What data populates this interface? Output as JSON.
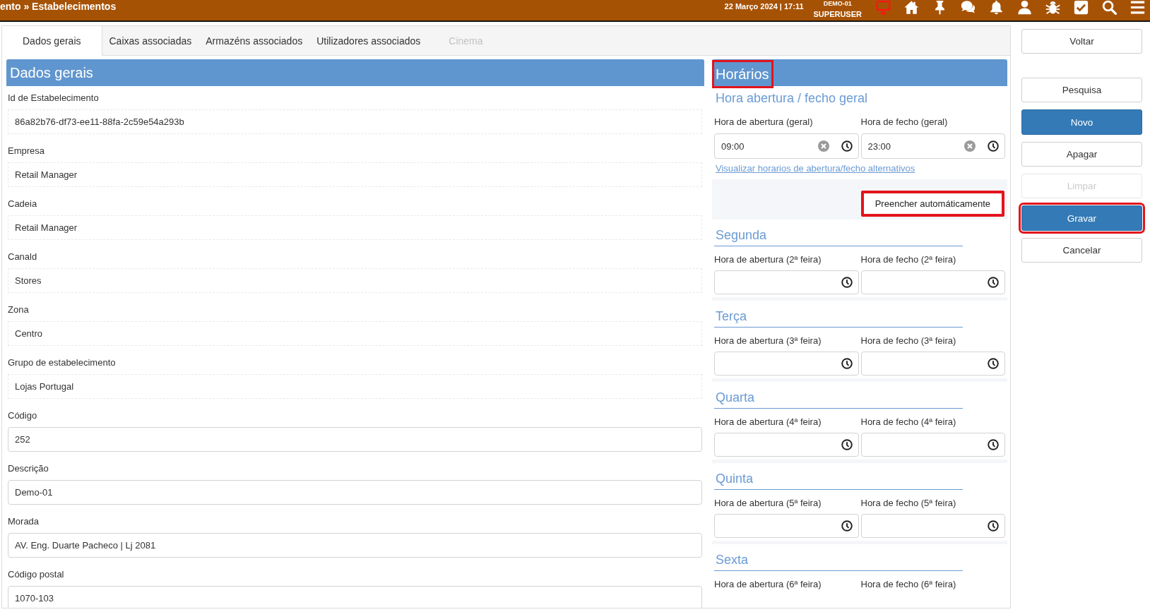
{
  "header": {
    "breadcrumb": "ento » Estabelecimentos",
    "datetime": "22 Março 2024 | 17:11",
    "user_lines": [
      "DEMO-01",
      "SUPERUSER"
    ],
    "monitor_alert": true
  },
  "tabs": [
    {
      "label": "Dados gerais",
      "selected": true,
      "disabled": false
    },
    {
      "label": "Caixas associadas",
      "selected": false,
      "disabled": false
    },
    {
      "label": "Armazéns associados",
      "selected": false,
      "disabled": false
    },
    {
      "label": "Utilizadores associados",
      "selected": false,
      "disabled": false
    },
    {
      "label": "Cinema",
      "selected": false,
      "disabled": true
    }
  ],
  "general_panel": {
    "title": "Dados gerais",
    "fields": [
      {
        "label": "Id de Estabelecimento",
        "value": "86a82b76-df73-ee11-88fa-2c59e54a293b",
        "kind": "readonly"
      },
      {
        "label": "Empresa",
        "value": "Retail Manager",
        "kind": "readonly"
      },
      {
        "label": "Cadeia",
        "value": "Retail Manager",
        "kind": "readonly"
      },
      {
        "label": "Canald",
        "value": "Stores",
        "kind": "readonly"
      },
      {
        "label": "Zona",
        "value": "Centro",
        "kind": "readonly"
      },
      {
        "label": "Grupo de estabelecimento",
        "value": "Lojas Portugal",
        "kind": "readonly"
      },
      {
        "label": "Código",
        "value": "252",
        "kind": "input"
      },
      {
        "label": "Descrição",
        "value": "Demo-01",
        "kind": "input"
      },
      {
        "label": "Morada",
        "value": "AV. Eng. Duarte Pacheco | Lj 2081",
        "kind": "input"
      },
      {
        "label": "Código postal",
        "value": "1070-103",
        "kind": "input"
      }
    ]
  },
  "hours_panel": {
    "title": "Horários",
    "title_highlighted": true,
    "general": {
      "heading": "Hora abertura / fecho geral",
      "fields": [
        {
          "label": "Hora de abertura (geral)",
          "value": "09:00"
        },
        {
          "label": "Hora de fecho (geral)",
          "value": "23:00"
        }
      ],
      "link": "Visualizar horarios de abertura/fecho alternativos"
    },
    "autofill_button": {
      "label": "Preencher automáticamente",
      "highlighted": true
    },
    "days": [
      {
        "name": "Segunda",
        "fields": [
          {
            "label": "Hora de abertura (2ª feira)",
            "input_shown": true
          },
          {
            "label": "Hora de fecho (2ª feira)",
            "input_shown": true
          }
        ]
      },
      {
        "name": "Terça",
        "fields": [
          {
            "label": "Hora de abertura (3ª feira)",
            "input_shown": true
          },
          {
            "label": "Hora de fecho (3ª feira)",
            "input_shown": true
          }
        ]
      },
      {
        "name": "Quarta",
        "fields": [
          {
            "label": "Hora de abertura (4ª feira)",
            "input_shown": true
          },
          {
            "label": "Hora de fecho (4ª feira)",
            "input_shown": true
          }
        ]
      },
      {
        "name": "Quinta",
        "fields": [
          {
            "label": "Hora de abertura (5ª feira)",
            "input_shown": true
          },
          {
            "label": "Hora de fecho (5ª feira)",
            "input_shown": true
          }
        ]
      },
      {
        "name": "Sexta",
        "fields": [
          {
            "label": "Hora de abertura (6ª feira)",
            "input_shown": false
          },
          {
            "label": "Hora de fecho (6ª feira)",
            "input_shown": false
          }
        ]
      }
    ]
  },
  "back_button": {
    "label": "Voltar"
  },
  "actions": [
    {
      "label": "Pesquisa",
      "kind": "default",
      "disabled": false,
      "highlighted": false
    },
    {
      "label": "Novo",
      "kind": "primary",
      "disabled": false,
      "highlighted": false
    },
    {
      "label": "Apagar",
      "kind": "default",
      "disabled": false,
      "highlighted": false
    },
    {
      "label": "Limpar",
      "kind": "default",
      "disabled": true,
      "highlighted": false
    },
    {
      "label": "Gravar",
      "kind": "primary",
      "disabled": false,
      "highlighted": true
    },
    {
      "label": "Cancelar",
      "kind": "default",
      "disabled": false,
      "highlighted": false
    }
  ]
}
